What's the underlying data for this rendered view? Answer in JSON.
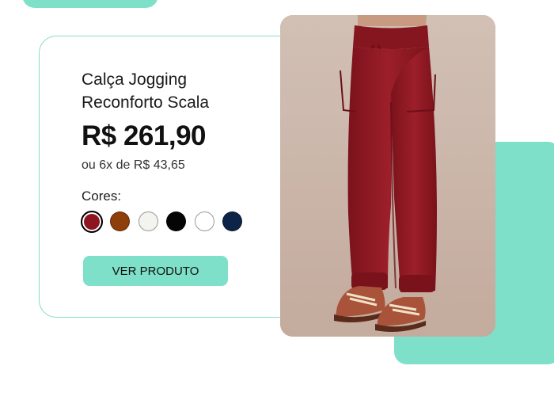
{
  "product": {
    "title_line1": "Calça Jogging",
    "title_line2": "Reconforto Scala",
    "price": "R$ 261,90",
    "installments": "ou 6x de R$ 43,65",
    "colors_label": "Cores:",
    "colors": [
      {
        "name": "vermelho",
        "hex": "#8d1420",
        "selected": true
      },
      {
        "name": "marrom",
        "hex": "#8e3e0b",
        "selected": false
      },
      {
        "name": "off-white",
        "hex": "#f3f3ef",
        "selected": false
      },
      {
        "name": "preto",
        "hex": "#050505",
        "selected": false
      },
      {
        "name": "branco",
        "hex": "#ffffff",
        "selected": false
      },
      {
        "name": "azul-marinho",
        "hex": "#0d2347",
        "selected": false
      }
    ],
    "cta_label": "VER PRODUTO"
  },
  "theme": {
    "accent": "#7ee0c8",
    "pants": "#8e1a22",
    "photo_background": "#cdb9ad"
  }
}
